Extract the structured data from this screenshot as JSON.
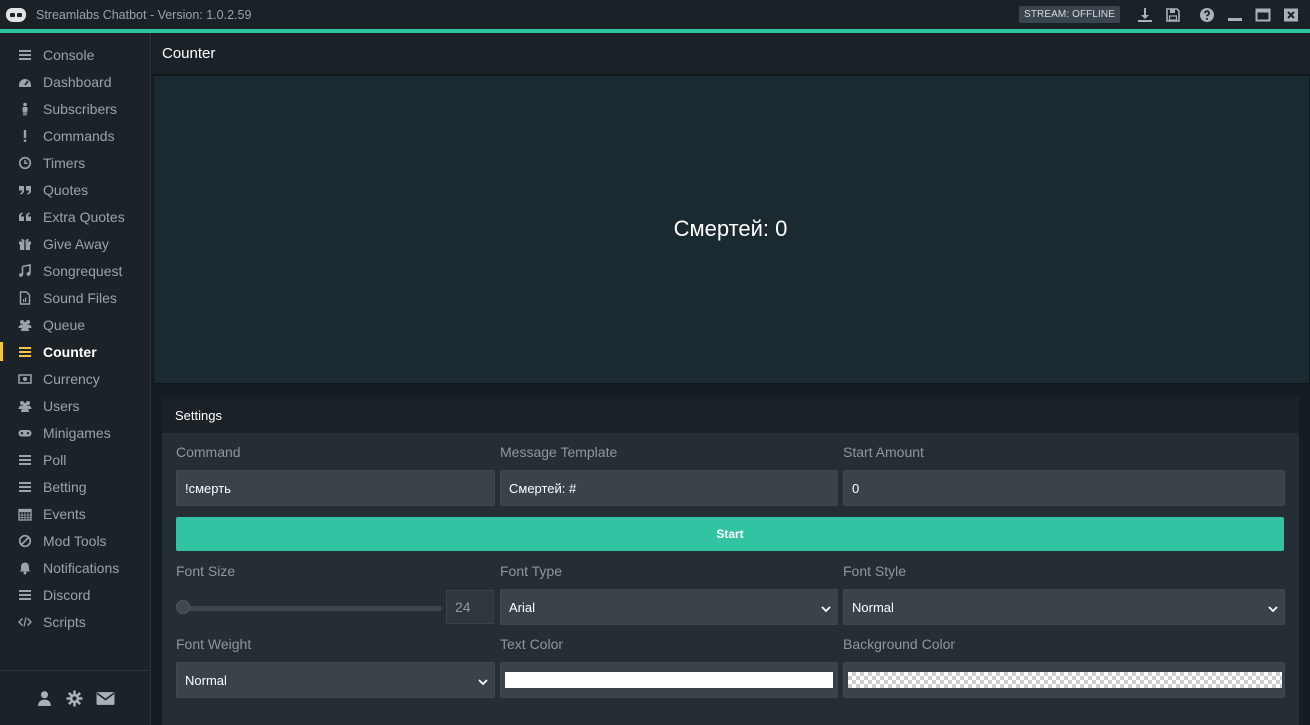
{
  "window": {
    "title": "Streamlabs Chatbot - Version: 1.0.2.59",
    "stream_status": "STREAM: OFFLINE",
    "icons": [
      "download-icon",
      "save-icon",
      "help-icon",
      "minimize-icon",
      "maximize-icon",
      "close-icon"
    ]
  },
  "sidebar": {
    "items": [
      {
        "label": "Console",
        "icon": "menu-icon"
      },
      {
        "label": "Dashboard",
        "icon": "dashboard-icon"
      },
      {
        "label": "Subscribers",
        "icon": "person-icon"
      },
      {
        "label": "Commands",
        "icon": "exclamation-icon"
      },
      {
        "label": "Timers",
        "icon": "clock-icon"
      },
      {
        "label": "Quotes",
        "icon": "quote-icon"
      },
      {
        "label": "Extra Quotes",
        "icon": "quote-open-icon"
      },
      {
        "label": "Give Away",
        "icon": "gift-icon"
      },
      {
        "label": "Songrequest",
        "icon": "music-icon"
      },
      {
        "label": "Sound Files",
        "icon": "sound-file-icon"
      },
      {
        "label": "Queue",
        "icon": "users-icon"
      },
      {
        "label": "Counter",
        "icon": "menu-icon",
        "active": true
      },
      {
        "label": "Currency",
        "icon": "money-icon"
      },
      {
        "label": "Users",
        "icon": "users-icon"
      },
      {
        "label": "Minigames",
        "icon": "gamepad-icon"
      },
      {
        "label": "Poll",
        "icon": "menu-icon"
      },
      {
        "label": "Betting",
        "icon": "menu-icon"
      },
      {
        "label": "Events",
        "icon": "calendar-icon"
      },
      {
        "label": "Mod Tools",
        "icon": "ban-icon"
      },
      {
        "label": "Notifications",
        "icon": "bell-icon"
      },
      {
        "label": "Discord",
        "icon": "menu-icon"
      },
      {
        "label": "Scripts",
        "icon": "code-icon"
      }
    ],
    "footer_icons": [
      "user-icon",
      "gear-icon",
      "envelope-icon"
    ]
  },
  "page": {
    "title": "Counter",
    "preview_text": "Смертей: 0"
  },
  "settings": {
    "title": "Settings",
    "command_label": "Command",
    "command_value": "!смерть",
    "template_label": "Message Template",
    "template_value": "Смертей: #",
    "start_amount_label": "Start Amount",
    "start_amount_value": "0",
    "start_button": "Start",
    "font_size_label": "Font Size",
    "font_size_value": "24",
    "font_type_label": "Font Type",
    "font_type_value": "Arial",
    "font_style_label": "Font Style",
    "font_style_value": "Normal",
    "font_weight_label": "Font Weight",
    "font_weight_value": "Normal",
    "text_color_label": "Text Color",
    "text_color": "#ffffff",
    "background_color_label": "Background Color",
    "background_color": "transparent"
  },
  "colors": {
    "accent": "#31c3a2",
    "active_nav": "#f2c744",
    "background": "#151c22"
  }
}
